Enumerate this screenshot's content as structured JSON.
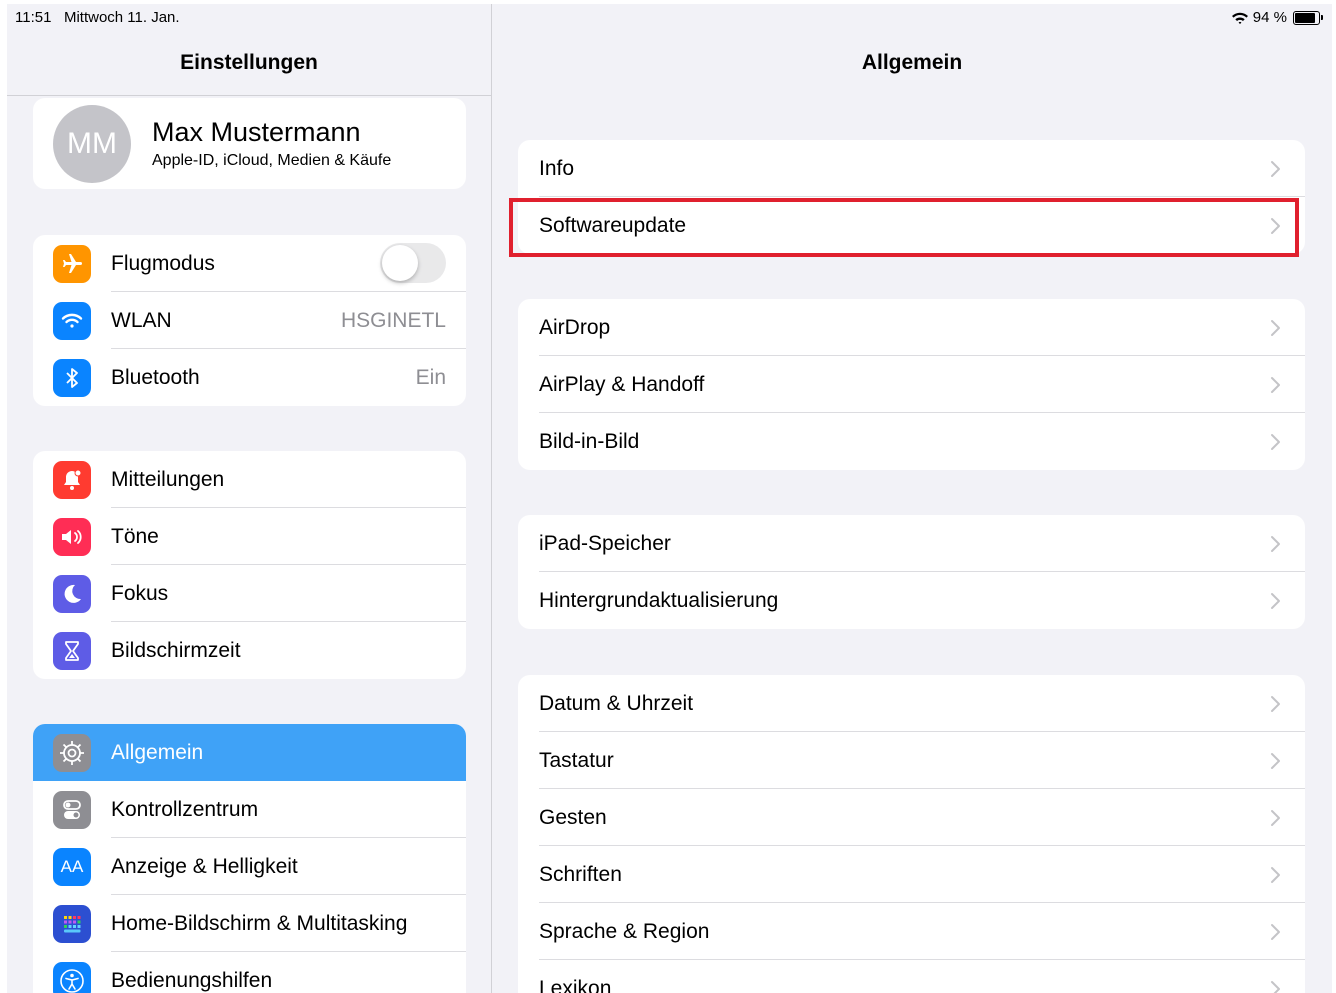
{
  "status_bar": {
    "time": "11:51",
    "date": "Mittwoch 11. Jan.",
    "battery": "94 %",
    "battery_level": 0.94
  },
  "sidebar": {
    "title": "Einstellungen",
    "profile": {
      "initials": "MM",
      "name": "Max Mustermann",
      "subtitle": "Apple-ID, iCloud, Medien & Käufe"
    },
    "groups": [
      [
        {
          "label": "Flugmodus",
          "icon": "airplane-icon",
          "color": "#ff9500",
          "toggle": false
        },
        {
          "label": "WLAN",
          "icon": "wifi-icon",
          "color": "#0a84ff",
          "value": "HSGINETL"
        },
        {
          "label": "Bluetooth",
          "icon": "bluetooth-icon",
          "color": "#0a84ff",
          "value": "Ein"
        }
      ],
      [
        {
          "label": "Mitteilungen",
          "icon": "notifications-icon",
          "color": "#ff3b30"
        },
        {
          "label": "Töne",
          "icon": "sound-icon",
          "color": "#ff2d55"
        },
        {
          "label": "Fokus",
          "icon": "moon-icon",
          "color": "#5e5ce6"
        },
        {
          "label": "Bildschirmzeit",
          "icon": "hourglass-icon",
          "color": "#5e5ce6"
        }
      ],
      [
        {
          "label": "Allgemein",
          "icon": "gear-icon",
          "color": "#8e8e93",
          "selected": true
        },
        {
          "label": "Kontrollzentrum",
          "icon": "switches-icon",
          "color": "#8e8e93"
        },
        {
          "label": "Anzeige & Helligkeit",
          "icon": "text-size-icon",
          "color": "#0a84ff",
          "glyph": "AA"
        },
        {
          "label": "Home-Bildschirm & Multitasking",
          "icon": "home-grid-icon",
          "color": "#2c4fd1"
        },
        {
          "label": "Bedienungshilfen",
          "icon": "accessibility-icon",
          "color": "#0a84ff"
        }
      ]
    ]
  },
  "detail": {
    "title": "Allgemein",
    "groups": [
      [
        "Info",
        "Softwareupdate"
      ],
      [
        "AirDrop",
        "AirPlay & Handoff",
        "Bild-in-Bild"
      ],
      [
        "iPad-Speicher",
        "Hintergrundaktualisierung"
      ],
      [
        "Datum & Uhrzeit",
        "Tastatur",
        "Gesten",
        "Schriften",
        "Sprache & Region",
        "Lexikon"
      ]
    ],
    "highlighted_item": "Softwareupdate",
    "highlight_color": "#e0202e"
  }
}
